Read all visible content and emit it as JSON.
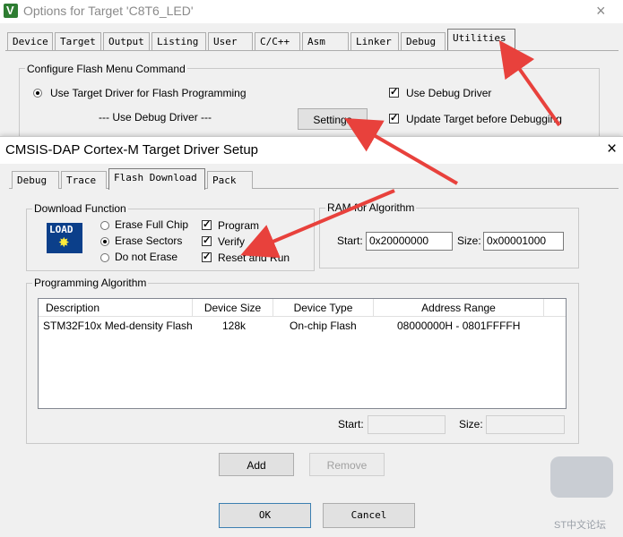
{
  "options_window": {
    "title": "Options for Target 'C8T6_LED'",
    "close_glyph": "×",
    "tabs": [
      "Device",
      "Target",
      "Output",
      "Listing",
      "User",
      "C/C++",
      "Asm",
      "Linker",
      "Debug",
      "Utilities"
    ],
    "active_tab": "Utilities",
    "flash_group_label": "Configure Flash Menu Command",
    "use_target_driver_label": "Use Target Driver for Flash Programming",
    "use_debug_driver_center": "--- Use Debug Driver ---",
    "settings_button": "Settings",
    "use_debug_driver_label": "Use Debug Driver",
    "use_debug_driver_checked": true,
    "update_target_label": "Update Target before Debugging",
    "update_target_checked": true
  },
  "dialog": {
    "title": "CMSIS-DAP Cortex-M Target Driver Setup",
    "close_glyph": "×",
    "tabs": [
      "Debug",
      "Trace",
      "Flash Download",
      "Pack"
    ],
    "active_tab": "Flash Download",
    "download_function": {
      "label": "Download Function",
      "icon_text": "LOAD",
      "radios": [
        {
          "label": "Erase Full Chip",
          "selected": false
        },
        {
          "label": "Erase Sectors",
          "selected": true
        },
        {
          "label": "Do not Erase",
          "selected": false
        }
      ],
      "checks": [
        {
          "label": "Program",
          "checked": true
        },
        {
          "label": "Verify",
          "checked": true
        },
        {
          "label": "Reset and Run",
          "checked": true
        }
      ]
    },
    "ram": {
      "label": "RAM for Algorithm",
      "start_label": "Start:",
      "start_value": "0x20000000",
      "size_label": "Size:",
      "size_value": "0x00001000"
    },
    "programming_algorithm": {
      "label": "Programming Algorithm",
      "columns": [
        "Description",
        "Device Size",
        "Device Type",
        "Address Range"
      ],
      "rows": [
        {
          "description": "STM32F10x Med-density Flash",
          "size": "128k",
          "type": "On-chip Flash",
          "range": "08000000H - 0801FFFFH"
        }
      ],
      "start_label": "Start:",
      "size_label": "Size:",
      "add_button": "Add",
      "remove_button": "Remove"
    },
    "ok_button": "OK",
    "cancel_button": "Cancel"
  },
  "watermark": {
    "text": "ST中文论坛"
  },
  "colors": {
    "annotation_arrow": "#e8413c",
    "load_icon": "#0b3f8a",
    "app_logo": "#2e7d32"
  }
}
